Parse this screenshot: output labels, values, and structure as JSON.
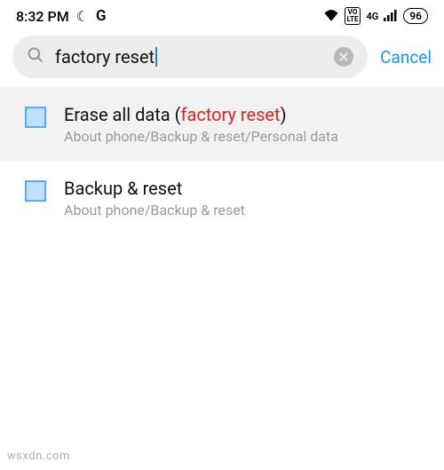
{
  "status": {
    "time": "8:32 PM",
    "moon_icon": "☾",
    "g_icon": "G",
    "wifi_icon": "wifi",
    "lte_badge": "VO LTE",
    "net_label": "4G",
    "battery": "96"
  },
  "search": {
    "query": "factory reset",
    "cancel": "Cancel"
  },
  "results": [
    {
      "title_pre": "Erase all data (",
      "title_hl": "factory reset",
      "title_post": ")",
      "path": "About phone/Backup & reset/Personal data",
      "selected": true
    },
    {
      "title_pre": "Backup & reset",
      "title_hl": "",
      "title_post": "",
      "path": "About phone/Backup & reset",
      "selected": false
    }
  ],
  "watermark": "wsxdn.com"
}
